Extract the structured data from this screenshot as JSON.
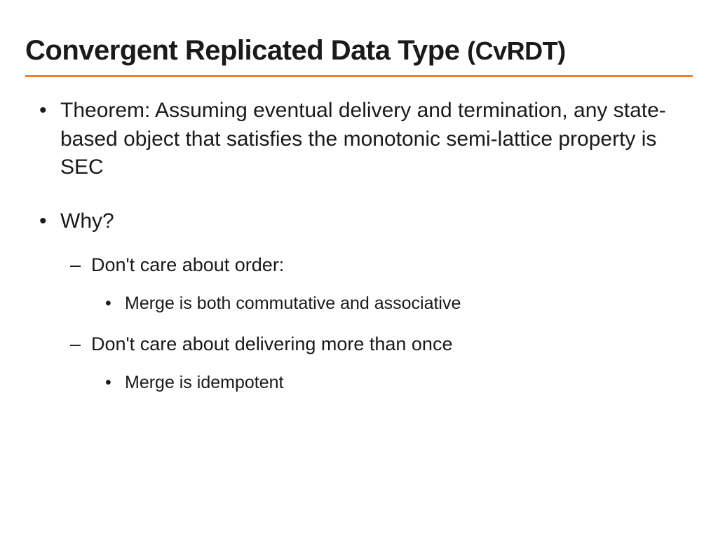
{
  "title_main": "Convergent Replicated Data Type ",
  "title_sub": "(CvRDT)",
  "bullets": {
    "b1": "Theorem: Assuming eventual delivery and termination, any state-based object that satisfies the monotonic semi-lattice property is SEC",
    "b2": "Why?",
    "b2_1": "Don't care about order:",
    "b2_1_1": "Merge is both commutative and associative",
    "b2_2": "Don't care about delivering more than once",
    "b2_2_1": "Merge is idempotent"
  },
  "colors": {
    "rule": "#ed7d31",
    "text": "#1a1a1a"
  }
}
